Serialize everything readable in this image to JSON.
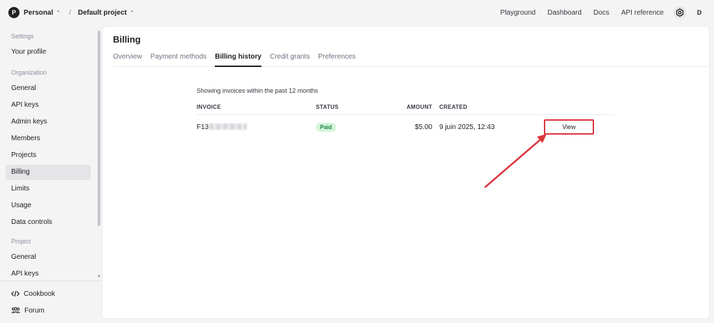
{
  "header": {
    "org_initial": "P",
    "org_name": "Personal",
    "project_name": "Default project",
    "nav": [
      "Playground",
      "Dashboard",
      "Docs",
      "API reference"
    ],
    "user_initial": "D"
  },
  "sidebar": {
    "sections": [
      {
        "label": "Settings",
        "items": [
          "Your profile"
        ]
      },
      {
        "label": "Organization",
        "items": [
          "General",
          "API keys",
          "Admin keys",
          "Members",
          "Projects",
          "Billing",
          "Limits",
          "Usage",
          "Data controls"
        ]
      },
      {
        "label": "Project",
        "items": [
          "General",
          "API keys"
        ]
      }
    ],
    "active_item": "Billing",
    "bottom": [
      {
        "label": "Cookbook",
        "icon": "code-icon"
      },
      {
        "label": "Forum",
        "icon": "people-icon"
      }
    ]
  },
  "main": {
    "title": "Billing",
    "tabs": [
      "Overview",
      "Payment methods",
      "Billing history",
      "Credit grants",
      "Preferences"
    ],
    "active_tab": "Billing history",
    "showing_text": "Showing invoices within the past 12 months",
    "columns": {
      "invoice": "INVOICE",
      "status": "STATUS",
      "amount": "AMOUNT",
      "created": "CREATED"
    },
    "rows": [
      {
        "invoice": "F13",
        "status": "Paid",
        "amount": "$5.00",
        "created": "9 juin 2025, 12:43",
        "action": "View"
      }
    ]
  },
  "colors": {
    "accent_red": "#d9363e",
    "paid_bg": "#d3f5dc",
    "paid_text": "#1a7f3c"
  }
}
